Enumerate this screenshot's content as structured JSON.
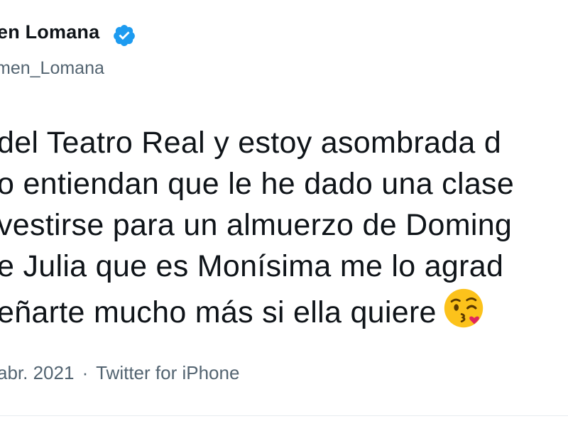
{
  "author": {
    "display_name": "en Lomana",
    "handle": "men_Lomana",
    "verified": true
  },
  "tweet": {
    "lines": [
      "del Teatro Real y estoy asombrada d",
      "o entiendan que le he dado una clase",
      "vestirse para un almuerzo de Doming",
      "e Julia que es Monísima me lo agrad",
      "eñarte mucho más si ella quiere"
    ],
    "emoji": "face-blowing-a-kiss-icon",
    "date": "abr. 2021",
    "separator": "·",
    "source": "Twitter for iPhone"
  },
  "colors": {
    "text": "#0f1419",
    "secondary": "#536471",
    "verified": "#1d9bf0",
    "divider": "#e6ecf0",
    "emoji_face": "#fcc21b",
    "emoji_heart": "#e0245e"
  }
}
